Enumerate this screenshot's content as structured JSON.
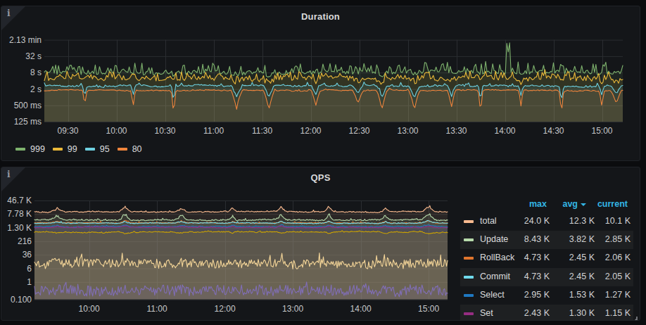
{
  "page": {
    "bg": "#0b0c0e",
    "panel_bg": "#141619",
    "grid_color": "#2a2d31",
    "axis_text_color": "#c7c8c9",
    "title_color": "#d8d9da",
    "header_blue": "#33b5e5",
    "info_icon": "i"
  },
  "panels": [
    {
      "id": "duration",
      "title": "Duration",
      "info_icon": "i"
    },
    {
      "id": "qps",
      "title": "QPS",
      "info_icon": "i"
    }
  ],
  "chart_data": [
    {
      "type": "line",
      "title": "Duration",
      "y_axis": {
        "scale": "log4",
        "unit": "duration-seconds",
        "ticks": [
          {
            "label": "2.13 min",
            "value": 128
          },
          {
            "label": "32 s",
            "value": 32
          },
          {
            "label": "8 s",
            "value": 8
          },
          {
            "label": "2 s",
            "value": 2
          },
          {
            "label": "500 ms",
            "value": 0.5
          },
          {
            "label": "125 ms",
            "value": 0.125
          }
        ]
      },
      "x_axis": {
        "ticks": [
          "09:30",
          "10:00",
          "10:30",
          "11:00",
          "11:30",
          "12:00",
          "12:30",
          "13:00",
          "13:30",
          "14:00",
          "14:30",
          "15:00"
        ],
        "visible_range": [
          "09:15",
          "15:13"
        ]
      },
      "legend": [
        {
          "label": "999",
          "color": "#7eb26d"
        },
        {
          "label": "99",
          "color": "#eab839"
        },
        {
          "label": "95",
          "color": "#6ed0e0"
        },
        {
          "label": "80",
          "color": "#ef843c"
        }
      ],
      "fill_opacity": 0.1,
      "dip_minutes": [
        25,
        55,
        80,
        119,
        139,
        168,
        194,
        209,
        229,
        252,
        270,
        295,
        320,
        345,
        354
      ],
      "series": [
        {
          "label": "999",
          "color": "#7eb26d",
          "gen": {
            "seed": 11,
            "base": 8.3,
            "wander": 0.07,
            "jitter": 0.17,
            "spike_p": 0.34,
            "spike_max": 2.15,
            "dip_resp": 0.12,
            "big_spike_minute": 287,
            "big_spike_mult": 6.3
          }
        },
        {
          "label": "99",
          "color": "#eab839",
          "gen": {
            "seed": 23,
            "base": 5.0,
            "wander": 0.08,
            "jitter": 0.2,
            "spike_p": 0.3,
            "spike_max": 1.75,
            "dip_resp": 0.25
          }
        },
        {
          "label": "95",
          "color": "#6ed0e0",
          "gen": {
            "seed": 37,
            "base": 2.6,
            "wander": 0.05,
            "jitter": 0.06,
            "spike_p": 0.06,
            "spike_max": 1.3,
            "dip_resp": 0.62
          }
        },
        {
          "label": "80",
          "color": "#ef843c",
          "gen": {
            "seed": 51,
            "base": 1.8,
            "wander": 0.04,
            "jitter": 0.04,
            "spike_p": 0.04,
            "spike_max": 1.12,
            "dip_resp": 1.0
          }
        }
      ]
    },
    {
      "type": "line",
      "title": "QPS",
      "y_axis": {
        "scale": "log6",
        "unit": "queries-per-second",
        "ticks": [
          {
            "label": "46.7 K",
            "value": 46656
          },
          {
            "label": "7.78 K",
            "value": 7776
          },
          {
            "label": "1.30 K",
            "value": 1296
          },
          {
            "label": "216",
            "value": 216
          },
          {
            "label": "36",
            "value": 36
          },
          {
            "label": "6",
            "value": 6
          },
          {
            "label": "1",
            "value": 1
          },
          {
            "label": "0.100",
            "value": 0.1
          }
        ]
      },
      "x_axis": {
        "ticks": [
          "10:00",
          "11:00",
          "12:00",
          "13:00",
          "14:00",
          "15:00"
        ],
        "visible_range": [
          "09:12",
          "15:17"
        ]
      },
      "legend_table": {
        "columns": [
          "max",
          "avg",
          "current"
        ],
        "sorted_by": "avg",
        "sort_direction": "desc",
        "rows": [
          {
            "label": "total",
            "color": "#f9ba8f",
            "max": "24.0 K",
            "avg": "12.3 K",
            "current": "10.1 K"
          },
          {
            "label": "Update",
            "color": "#b7dbab",
            "max": "8.43 K",
            "avg": "3.82 K",
            "current": "2.85 K"
          },
          {
            "label": "RollBack",
            "color": "#e0752d",
            "max": "4.73 K",
            "avg": "2.45 K",
            "current": "2.06 K"
          },
          {
            "label": "Commit",
            "color": "#70dbed",
            "max": "4.73 K",
            "avg": "2.45 K",
            "current": "2.05 K"
          },
          {
            "label": "Select",
            "color": "#1f78c1",
            "max": "2.95 K",
            "avg": "1.53 K",
            "current": "1.27 K"
          },
          {
            "label": "Set",
            "color": "#962d82",
            "max": "2.43 K",
            "avg": "1.30 K",
            "current": "1.15 K"
          }
        ]
      },
      "fill_opacity": 0.1,
      "bump_minutes": [
        20,
        80,
        130,
        175,
        218,
        260,
        310,
        348
      ],
      "series": [
        {
          "label": "total",
          "color": "#f9ba8f",
          "gen": {
            "seed": 101,
            "base": 10600,
            "wander": 0.04,
            "jitter": 0.06,
            "spike_p": 0.06,
            "spike_max": 1.2,
            "bump": 0.85
          }
        },
        {
          "label": "Update",
          "color": "#b7dbab",
          "gen": {
            "seed": 113,
            "base": 3550,
            "wander": 0.05,
            "jitter": 0.07,
            "spike_p": 0.05,
            "spike_max": 1.25,
            "bump": 1.0
          }
        },
        {
          "label": "RollBack",
          "color": "#e0752d",
          "gen": {
            "seed": 127,
            "base": 2420,
            "wander": 0.035,
            "jitter": 0.045,
            "spike_p": 0.03,
            "spike_max": 1.2,
            "bump": 0.35
          }
        },
        {
          "label": "Commit",
          "color": "#70dbed",
          "gen": {
            "seed": 139,
            "base": 2330,
            "wander": 0.035,
            "jitter": 0.045,
            "spike_p": 0.03,
            "spike_max": 1.2,
            "bump": 0.35
          }
        },
        {
          "label": "Select",
          "color": "#1f78c1",
          "gen": {
            "seed": 151,
            "base": 1500,
            "wander": 0.035,
            "jitter": 0.045,
            "spike_p": 0.03,
            "spike_max": 1.15,
            "bump": 0.3
          }
        },
        {
          "label": "Set",
          "color": "#962d82",
          "gen": {
            "seed": 163,
            "base": 1320,
            "wander": 0.035,
            "jitter": 0.045,
            "spike_p": 0.03,
            "spike_max": 1.15,
            "bump": 0.28
          }
        },
        {
          "label": "",
          "color": "#cca300",
          "gen": {
            "seed": 177,
            "base": 720,
            "wander": 0.06,
            "jitter": 0.055,
            "spike_p": 0.03,
            "spike_max": 1.15,
            "bump": -0.3
          }
        },
        {
          "label": "",
          "color": "#f4d598",
          "gen": {
            "seed": 191,
            "base": 11.0,
            "wander": 0.1,
            "jitter": 0.6,
            "spike_p": 0.09,
            "spike_max": 2.6,
            "bump": 0.25
          }
        },
        {
          "label": "",
          "color": "#806eb7",
          "gen": {
            "seed": 207,
            "base": 0.33,
            "wander": 0.08,
            "jitter": 0.7,
            "spike_p": 0.05,
            "spike_max": 2.0,
            "bump": 0.15
          }
        }
      ]
    }
  ]
}
